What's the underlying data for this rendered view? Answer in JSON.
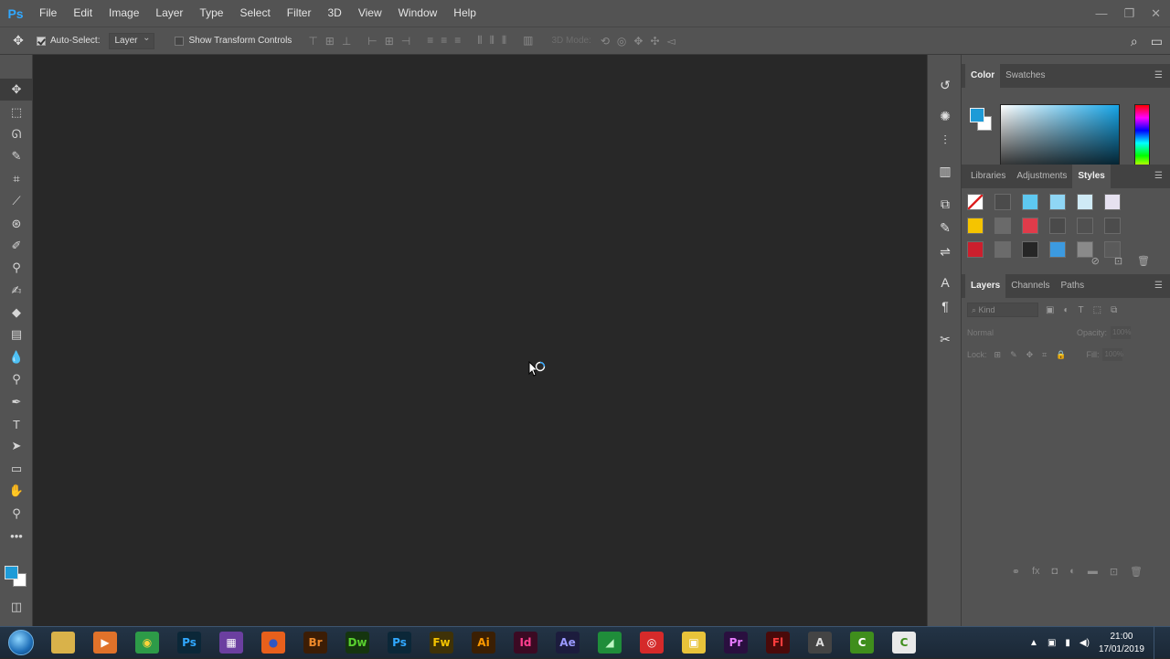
{
  "app": {
    "logo": "Ps",
    "menu": [
      "File",
      "Edit",
      "Image",
      "Layer",
      "Type",
      "Select",
      "Filter",
      "3D",
      "View",
      "Window",
      "Help"
    ],
    "window_controls": [
      "—",
      "❐",
      "✕"
    ]
  },
  "options_bar": {
    "auto_select_label": "Auto-Select:",
    "auto_select_checked": true,
    "auto_select_target": "Layer",
    "show_transform_label": "Show Transform Controls",
    "show_transform_checked": false,
    "mode_3d_label": "3D Mode:"
  },
  "colors": {
    "foreground": "#1e9bd7",
    "background": "#ffffff",
    "accent": "#31a8ff"
  },
  "color_panel": {
    "tabs": [
      "Color",
      "Swatches"
    ],
    "active_tab": "Color"
  },
  "styles_panel": {
    "tabs": [
      "Libraries",
      "Adjustments",
      "Styles"
    ],
    "active_tab": "Styles",
    "swatches": [
      "#ffffff",
      "#4b4b4b",
      "#5ec8f0",
      "#8fd6f5",
      "#cfeaf5",
      "#e6e1f0",
      "#f5c400",
      "#6a6a6a",
      "#e03b4a",
      "#4a4a4a",
      "#505050",
      "#4c4c4c",
      "#cc1f2d",
      "#6b6b6b",
      "#262626",
      "#3c9ae0",
      "#8a8a8a",
      "#5a5a5a"
    ]
  },
  "layers_panel": {
    "tabs": [
      "Layers",
      "Channels",
      "Paths"
    ],
    "active_tab": "Layers",
    "filter_kind": "Kind",
    "blend_mode": "Normal",
    "opacity_label": "Opacity:",
    "opacity_value": "100%",
    "lock_label": "Lock:",
    "fill_label": "Fill:",
    "fill_value": "100%"
  },
  "taskbar": {
    "apps": [
      {
        "name": "explorer",
        "label": "",
        "bg": "#d9b24a",
        "fg": "#ffffff"
      },
      {
        "name": "media-player",
        "label": "▶",
        "bg": "#e0722a",
        "fg": "#ffffff"
      },
      {
        "name": "chrome",
        "label": "◉",
        "bg": "#2d9b48",
        "fg": "#ffd43b"
      },
      {
        "name": "photoshop",
        "label": "Ps",
        "bg": "#0b2738",
        "fg": "#31a8ff"
      },
      {
        "name": "winrar",
        "label": "▦",
        "bg": "#6b3fa0",
        "fg": "#ffffff"
      },
      {
        "name": "firefox",
        "label": "●",
        "bg": "#e8601c",
        "fg": "#2f56c4"
      },
      {
        "name": "bridge",
        "label": "Br",
        "bg": "#3c1d05",
        "fg": "#ef8a2b"
      },
      {
        "name": "dreamweaver",
        "label": "Dw",
        "bg": "#15350f",
        "fg": "#59d12f"
      },
      {
        "name": "photoshop-2",
        "label": "Ps",
        "bg": "#0b2738",
        "fg": "#31a8ff"
      },
      {
        "name": "fireworks",
        "label": "Fw",
        "bg": "#3f3207",
        "fg": "#f5c400"
      },
      {
        "name": "illustrator",
        "label": "Ai",
        "bg": "#3b1f03",
        "fg": "#ff9a00"
      },
      {
        "name": "indesign",
        "label": "Id",
        "bg": "#3b0a23",
        "fg": "#ff3f8f"
      },
      {
        "name": "after-effects",
        "label": "Ae",
        "bg": "#1c1c3d",
        "fg": "#9a99ff"
      },
      {
        "name": "app-green",
        "label": "◢",
        "bg": "#1f8d3a",
        "fg": "#bff5c4"
      },
      {
        "name": "app-red",
        "label": "◎",
        "bg": "#d52a2a",
        "fg": "#ffffff"
      },
      {
        "name": "app-yellow",
        "label": "▣",
        "bg": "#e8c33a",
        "fg": "#ffffff"
      },
      {
        "name": "premiere",
        "label": "Pr",
        "bg": "#2a0f3f",
        "fg": "#e77bff"
      },
      {
        "name": "flash",
        "label": "Fl",
        "bg": "#4a0a0a",
        "fg": "#ff3d3d"
      },
      {
        "name": "app-acrobat",
        "label": "A",
        "bg": "#444444",
        "fg": "#dddddd"
      },
      {
        "name": "app-camtasia",
        "label": "C",
        "bg": "#3f8e1c",
        "fg": "#ffffff"
      },
      {
        "name": "app-camtasia-2",
        "label": "C",
        "bg": "#e9e9e9",
        "fg": "#3f8e1c"
      }
    ],
    "time": "21:00",
    "date": "17/01/2019"
  }
}
